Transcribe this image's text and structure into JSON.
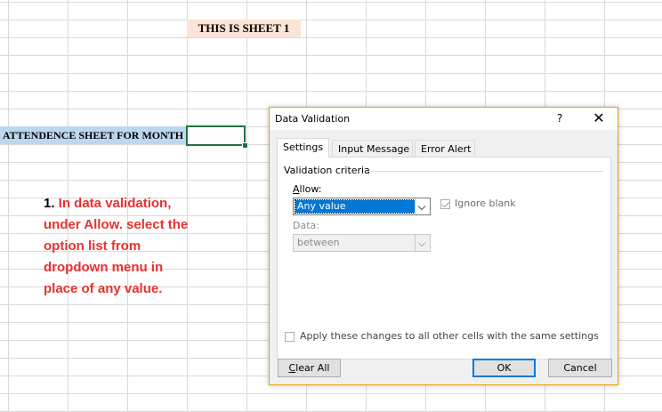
{
  "sheet": {
    "title": "THIS IS SHEET 1",
    "attendance_label": "ATTENDENCE SHEET FOR MONTH",
    "instruction_num": "1.",
    "instruction_text": " In data validation, under Allow. select the option list from dropdown menu in place of any value."
  },
  "dialog": {
    "title": "Data Validation",
    "help_label": "?",
    "close_label": "✕",
    "tabs": [
      {
        "label": "Settings",
        "active": true
      },
      {
        "label": "Input Message",
        "active": false
      },
      {
        "label": "Error Alert",
        "active": false
      }
    ],
    "criteria_label": "Validation criteria",
    "allow_label": "Allow:",
    "allow_value": "Any value",
    "ignore_blank_label": "Ignore blank",
    "ignore_blank_checked": true,
    "data_label": "Data:",
    "data_value": "between",
    "apply_label": "Apply these changes to all other cells with the same settings",
    "apply_checked": false,
    "buttons": {
      "clear_all": "Clear All",
      "ok": "OK",
      "cancel": "Cancel"
    }
  },
  "colors": {
    "accent": "#0078d7",
    "excel_green": "#217346",
    "instruction_red": "#e8312f",
    "title_fill": "#fce4d6",
    "label_fill": "#bdd7ee"
  }
}
